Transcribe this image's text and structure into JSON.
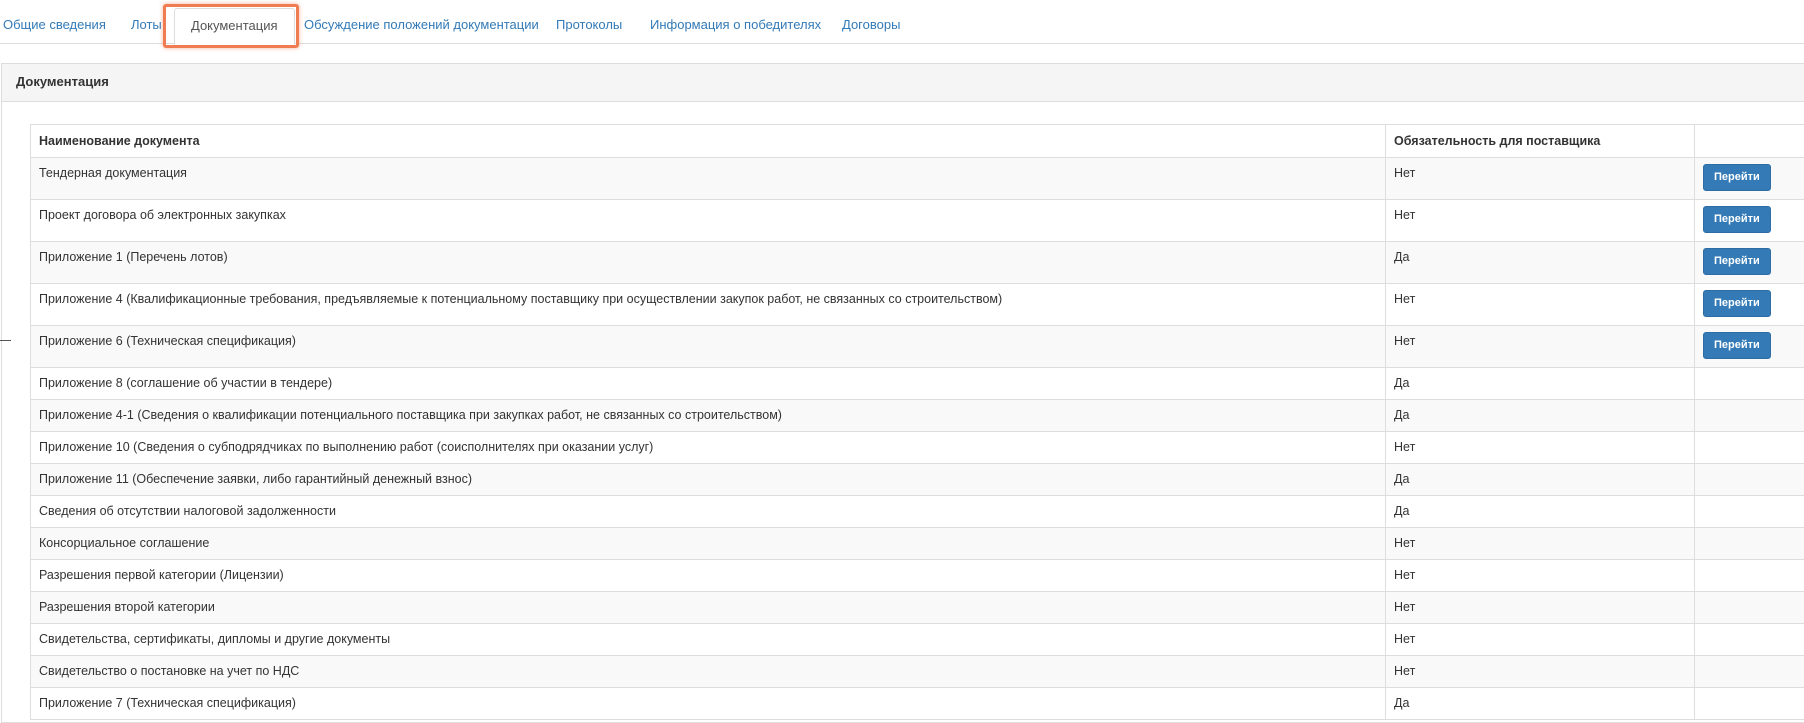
{
  "tabs": [
    {
      "label": "Общие сведения"
    },
    {
      "label": "Лоты"
    },
    {
      "label": "Документация"
    },
    {
      "label": "Обсуждение положений документации"
    },
    {
      "label": "Протоколы"
    },
    {
      "label": "Информация о победителях"
    },
    {
      "label": "Договоры"
    }
  ],
  "panel": {
    "title": "Документация"
  },
  "table": {
    "headers": [
      "Наименование документа",
      "Обязательность для поставщика",
      ""
    ],
    "rows": [
      {
        "name": "Тендерная документация",
        "required": "Нет",
        "action": "Перейти"
      },
      {
        "name": "Проект договора об электронных закупках",
        "required": "Нет",
        "action": "Перейти"
      },
      {
        "name": "Приложение 1 (Перечень лотов)",
        "required": "Да",
        "action": "Перейти"
      },
      {
        "name": "Приложение 4 (Квалификационные требования, предъявляемые к потенциальному поставщику при осуществлении закупок работ, не связанных со строительством)",
        "required": "Нет",
        "action": "Перейти"
      },
      {
        "name": "Приложение 6 (Техническая спецификация)",
        "required": "Нет",
        "action": "Перейти"
      },
      {
        "name": "Приложение 8 (соглашение об участии в тендере)",
        "required": "Да",
        "action": ""
      },
      {
        "name": "Приложение 4-1 (Сведения о квалификации потенциального поставщика при закупках работ, не связанных со строительством)",
        "required": "Да",
        "action": ""
      },
      {
        "name": "Приложение 10 (Сведения о субподрядчиках по выполнению работ (соисполнителях при оказании услуг)",
        "required": "Нет",
        "action": ""
      },
      {
        "name": "Приложение 11 (Обеспечение заявки, либо гарантийный денежный взнос)",
        "required": "Да",
        "action": ""
      },
      {
        "name": "Сведения об отсутствии налоговой задолженности",
        "required": "Да",
        "action": ""
      },
      {
        "name": "Консорциальное соглашение",
        "required": "Нет",
        "action": ""
      },
      {
        "name": "Разрешения первой категории (Лицензии)",
        "required": "Нет",
        "action": ""
      },
      {
        "name": "Разрешения второй категории",
        "required": "Нет",
        "action": ""
      },
      {
        "name": "Свидетельства, сертификаты, дипломы и другие документы",
        "required": "Нет",
        "action": ""
      },
      {
        "name": "Свидетельство о постановке на учет по НДС",
        "required": "Нет",
        "action": ""
      },
      {
        "name": "Приложение 7 (Техническая спецификация)",
        "required": "Да",
        "action": ""
      }
    ]
  }
}
